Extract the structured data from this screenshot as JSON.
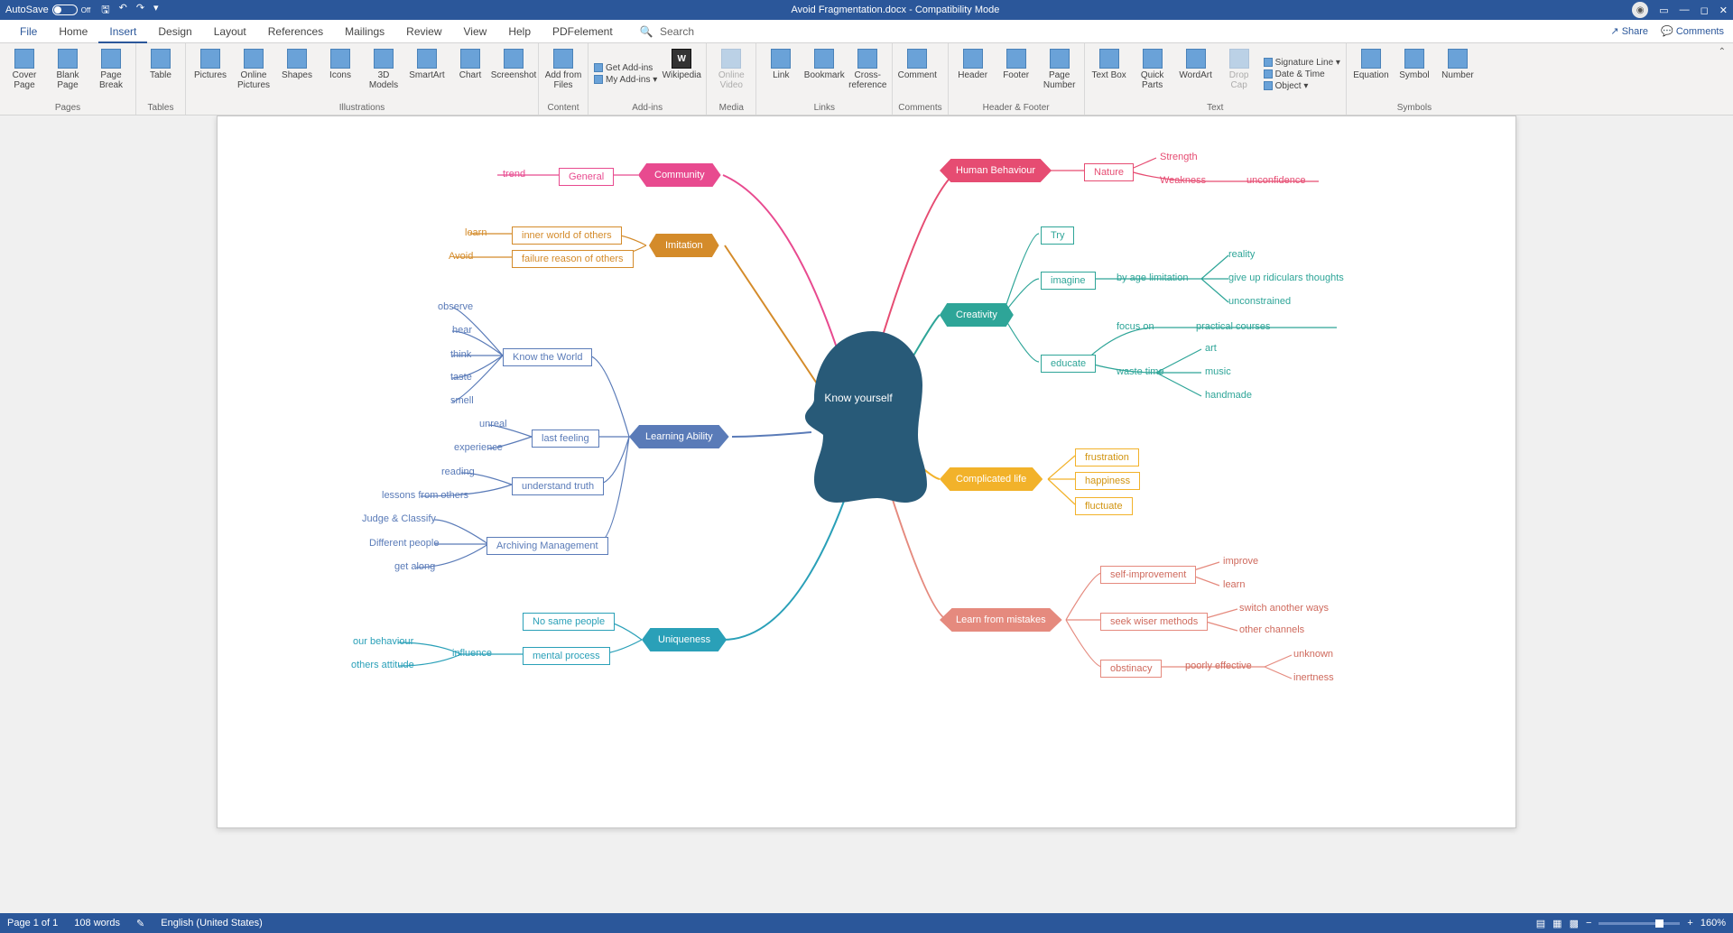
{
  "titlebar": {
    "autosave_label": "AutoSave",
    "autosave_state": "Off",
    "document_title": "Avoid Fragmentation.docx  -  Compatibility Mode"
  },
  "tabs": {
    "file": "File",
    "home": "Home",
    "insert": "Insert",
    "design": "Design",
    "layout": "Layout",
    "references": "References",
    "mailings": "Mailings",
    "review": "Review",
    "view": "View",
    "help": "Help",
    "pdfelement": "PDFelement",
    "search": "Search",
    "share": "Share",
    "comments": "Comments"
  },
  "ribbon": {
    "cover_page": "Cover Page",
    "blank_page": "Blank Page",
    "page_break": "Page Break",
    "pages": "Pages",
    "table": "Table",
    "tables": "Tables",
    "pictures": "Pictures",
    "online_pictures": "Online Pictures",
    "shapes": "Shapes",
    "icons": "Icons",
    "models": "3D Models",
    "smartart": "SmartArt",
    "chart": "Chart",
    "screenshot": "Screenshot",
    "illustrations": "Illustrations",
    "add_from_files": "Add from Files",
    "content": "Content",
    "get_addins": "Get Add-ins",
    "my_addins": "My Add-ins",
    "wikipedia": "Wikipedia",
    "addins": "Add-ins",
    "online_video": "Online Video",
    "media": "Media",
    "link": "Link",
    "bookmark": "Bookmark",
    "cross_reference": "Cross-reference",
    "links": "Links",
    "comment": "Comment",
    "comments_grp": "Comments",
    "header": "Header",
    "footer": "Footer",
    "page_number": "Page Number",
    "header_footer": "Header & Footer",
    "text_box": "Text Box",
    "quick_parts": "Quick Parts",
    "wordart": "WordArt",
    "drop_cap": "Drop Cap",
    "signature": "Signature Line",
    "date_time": "Date & Time",
    "object": "Object",
    "text": "Text",
    "equation": "Equation",
    "symbol": "Symbol",
    "number": "Number",
    "symbols": "Symbols"
  },
  "mindmap": {
    "center": "Know yourself",
    "community": {
      "label": "Community",
      "general": "General",
      "trend": "trend"
    },
    "imitation": {
      "label": "Imitation",
      "inner": "inner world of others",
      "failure": "failure reason of others",
      "learn": "learn",
      "avoid": "Avoid"
    },
    "learning": {
      "label": "Learning Ability",
      "know_world": "Know the World",
      "senses": {
        "observe": "observe",
        "hear": "hear",
        "think": "think",
        "taste": "taste",
        "smell": "smell"
      },
      "last_feeling": "last feeling",
      "unreal": "unreal",
      "experience": "experience",
      "understand": "understand truth",
      "reading": "reading",
      "lessons": "lessons from others",
      "archiving": "Archiving Management",
      "judge": "Judge & Classify",
      "different": "Different people",
      "getalong": "get along"
    },
    "uniqueness": {
      "label": "Uniqueness",
      "nosame": "No same people",
      "mental": "mental process",
      "influence": "influence",
      "our": "our behaviour",
      "others": "others attitude"
    },
    "human": {
      "label": "Human Behaviour",
      "nature": "Nature",
      "strength": "Strength",
      "weakness": "Weakness",
      "unconfidence": "unconfidence"
    },
    "creativity": {
      "label": "Creativity",
      "try": "Try",
      "imagine": "imagine",
      "educate": "educate",
      "byage": "by age limitation",
      "reality": "reality",
      "giveup": "give up ridiculars thoughts",
      "unconstrained": "unconstrained",
      "focus": "focus on",
      "practical": "practical courses",
      "waste": "waste time",
      "art": "art",
      "music": "music",
      "handmade": "handmade"
    },
    "complicated": {
      "label": "Complicated life",
      "frustration": "frustration",
      "happiness": "happiness",
      "fluctuate": "fluctuate"
    },
    "mistakes": {
      "label": "Learn from mistakes",
      "selfimp": "self-improvement",
      "improve": "improve",
      "learn": "learn",
      "seek": "seek wiser methods",
      "switch": "switch another ways",
      "channels": "other channels",
      "obstinacy": "obstinacy",
      "poorly": "poorly  effective",
      "unknown": "unknown",
      "inertness": "inertness"
    }
  },
  "status": {
    "page": "Page 1 of 1",
    "words": "108 words",
    "lang": "English (United States)",
    "zoom": "160%"
  }
}
